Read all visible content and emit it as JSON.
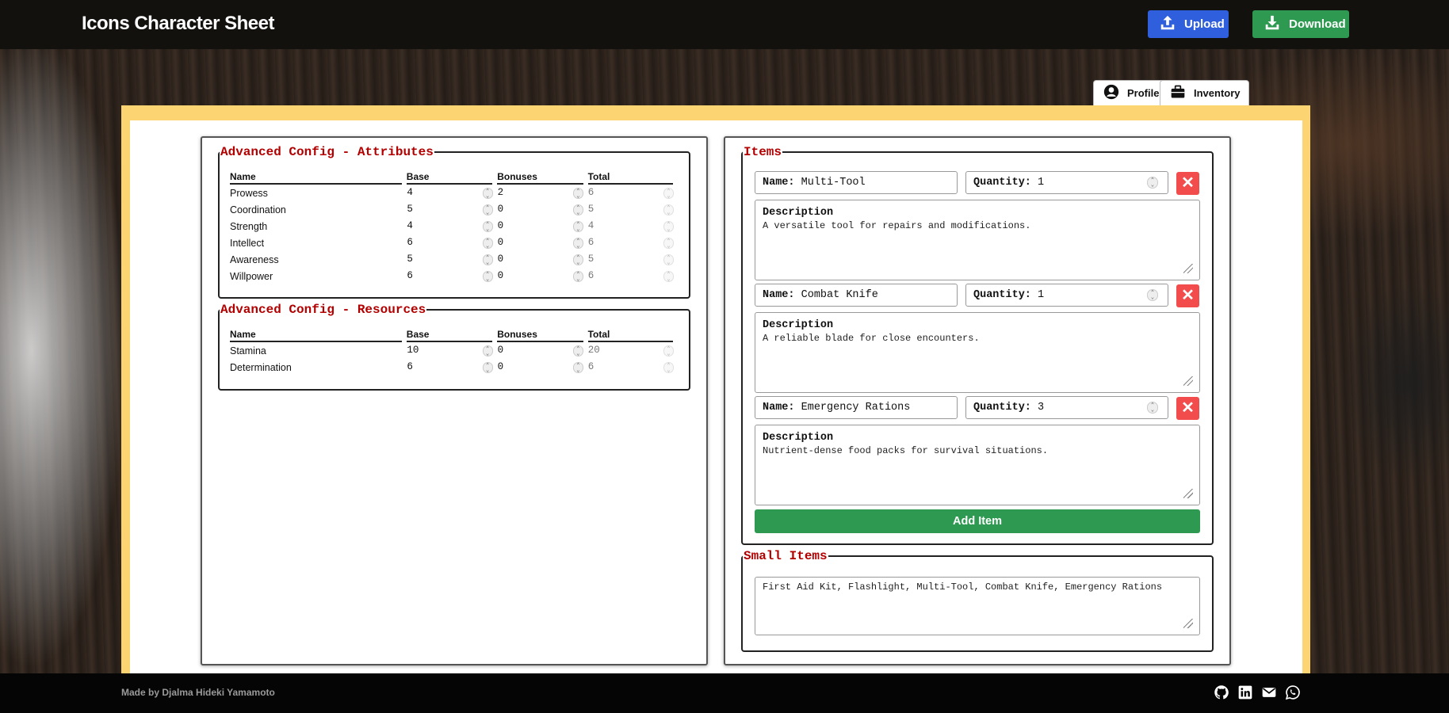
{
  "header": {
    "title": "Icons Character Sheet",
    "upload_label": "Upload",
    "download_label": "Download"
  },
  "tabs": [
    {
      "label": "Profile",
      "icon": "user-circle-icon"
    },
    {
      "label": "Inventory",
      "icon": "briefcase-icon",
      "active": true
    }
  ],
  "attributes": {
    "legend": "Advanced Config - Attributes",
    "columns": [
      "Name",
      "Base",
      "Bonuses",
      "Total"
    ],
    "rows": [
      {
        "name": "Prowess",
        "base": "4",
        "bonuses": "2",
        "total": "6"
      },
      {
        "name": "Coordination",
        "base": "5",
        "bonuses": "0",
        "total": "5"
      },
      {
        "name": "Strength",
        "base": "4",
        "bonuses": "0",
        "total": "4"
      },
      {
        "name": "Intellect",
        "base": "6",
        "bonuses": "0",
        "total": "6"
      },
      {
        "name": "Awareness",
        "base": "5",
        "bonuses": "0",
        "total": "5"
      },
      {
        "name": "Willpower",
        "base": "6",
        "bonuses": "0",
        "total": "6"
      }
    ]
  },
  "resources": {
    "legend": "Advanced Config - Resources",
    "columns": [
      "Name",
      "Base",
      "Bonuses",
      "Total"
    ],
    "rows": [
      {
        "name": "Stamina",
        "base": "10",
        "bonuses": "0",
        "total": "20"
      },
      {
        "name": "Determination",
        "base": "6",
        "bonuses": "0",
        "total": "6"
      }
    ]
  },
  "items": {
    "legend": "Items",
    "name_label": "Name:",
    "quantity_label": "Quantity:",
    "description_label": "Description",
    "list": [
      {
        "name": "Multi-Tool",
        "quantity": "1",
        "description": "A versatile tool for repairs and modifications."
      },
      {
        "name": "Combat Knife",
        "quantity": "1",
        "description": "A reliable blade for close encounters."
      },
      {
        "name": "Emergency Rations",
        "quantity": "3",
        "description": "Nutrient-dense food packs for survival situations."
      }
    ],
    "add_label": "Add Item",
    "delete_glyph": "✕"
  },
  "small_items": {
    "legend": "Small Items",
    "value": "First Aid Kit, Flashlight, Multi-Tool, Combat Knife, Emergency Rations"
  },
  "footer": {
    "credit": "Made by Djalma Hideki Yamamoto",
    "icons": [
      "github-icon",
      "linkedin-icon",
      "email-icon",
      "whatsapp-icon"
    ]
  },
  "colors": {
    "header_bg": "#12110e",
    "upload": "#2f5fdd",
    "download": "#2e9a51",
    "frame": "#fcd572",
    "legend": "#b30000",
    "delete": "#f24c4c",
    "add": "#2e9a51"
  }
}
